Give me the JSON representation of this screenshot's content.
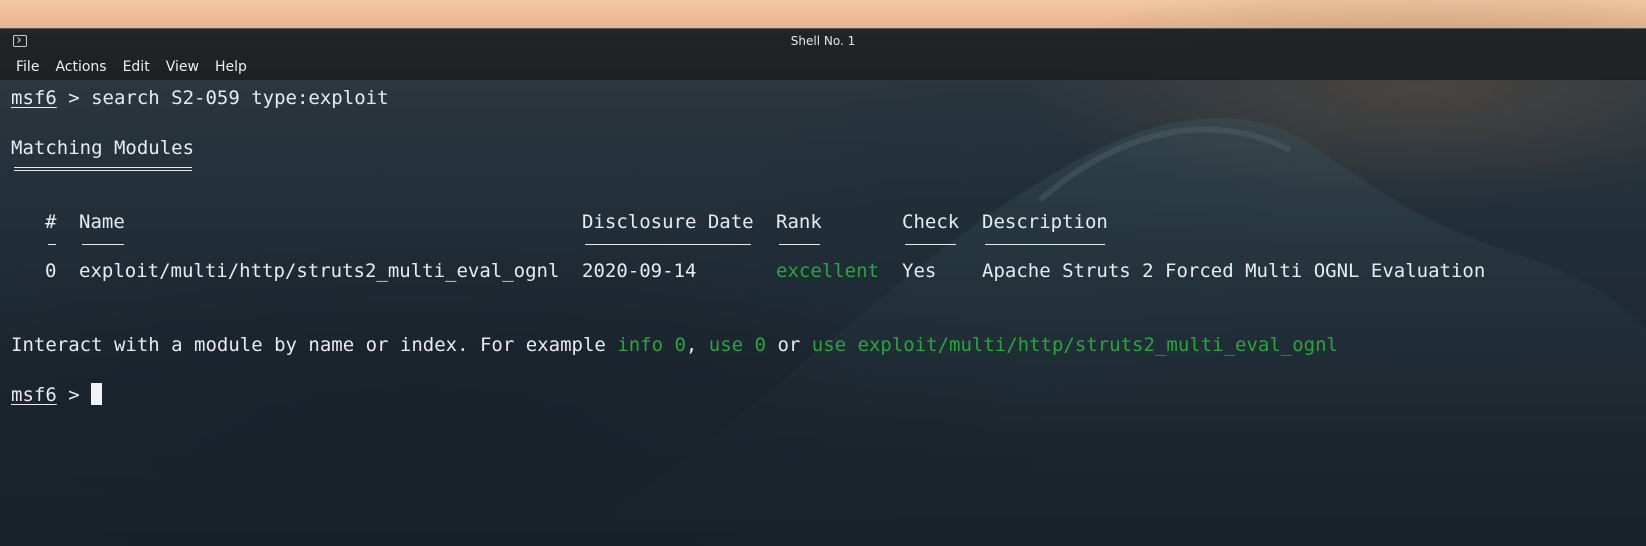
{
  "window": {
    "title": "Shell No. 1"
  },
  "menu": [
    "File",
    "Actions",
    "Edit",
    "View",
    "Help"
  ],
  "terminal": {
    "prompt": "msf6",
    "prompt_sep": " > ",
    "command": "search S2-059 type:exploit",
    "section_heading": "Matching Modules",
    "table": {
      "headers": [
        "#",
        "Name",
        "Disclosure Date",
        "Rank",
        "Check",
        "Description"
      ],
      "header_underline": [
        "-",
        "----",
        "---------------",
        "----",
        "-----",
        "-----------"
      ],
      "rows": [
        {
          "index": "0",
          "name": "exploit/multi/http/struts2_multi_eval_ognl",
          "date": "2020-09-14",
          "rank": "excellent",
          "check": "Yes",
          "description": "Apache Struts 2 Forced Multi OGNL Evaluation"
        }
      ]
    },
    "hint": {
      "prefix": "Interact with a module by name or index. For example ",
      "cmd1": "info 0",
      "sep1": ", ",
      "cmd2": "use 0",
      "sep2": " or ",
      "cmd3": "use exploit/multi/http/struts2_multi_eval_ognl"
    }
  },
  "colors": {
    "green": "#25a83a",
    "text": "#e8ebee"
  }
}
